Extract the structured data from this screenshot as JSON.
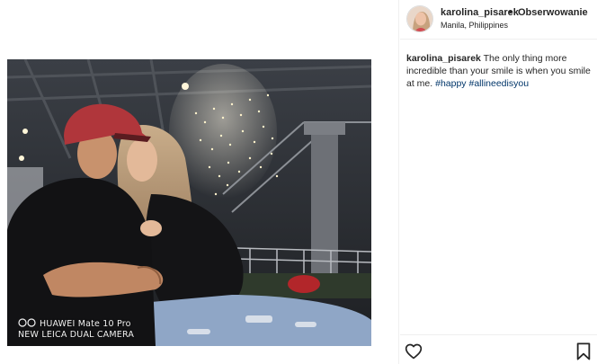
{
  "post": {
    "author": {
      "username": "karolina_pisarek",
      "separator": "•",
      "follow_label": "Obserwowanie",
      "location": "Manila, Philippines",
      "avatar_icon": "avatar-photo"
    },
    "caption": {
      "username": "karolina_pisarek",
      "text": " The only thing more incredible than your smile is when you smile at me. ",
      "hashtags": [
        "#happy",
        "#allineedisyou"
      ]
    },
    "photo": {
      "watermark_line1": "HUAWEI Mate 10 Pro",
      "watermark_line2": "NEW LEICA DUAL CAMERA"
    },
    "actions": {
      "like_icon": "heart-outline-icon",
      "save_icon": "bookmark-outline-icon"
    }
  },
  "colors": {
    "text": "#262626",
    "hashtag": "#003569",
    "border": "#efefef"
  }
}
